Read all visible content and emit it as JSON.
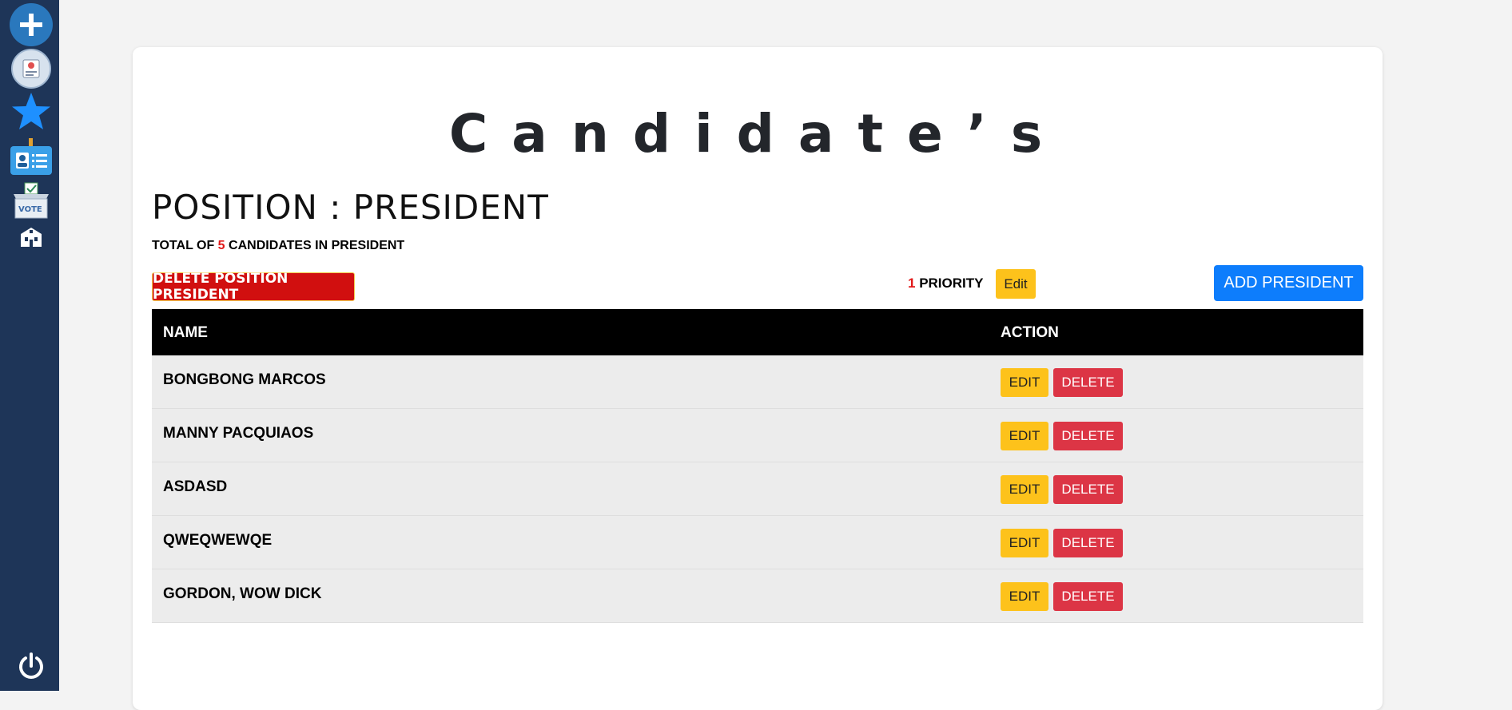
{
  "sidebar": {
    "icons": [
      "plus-icon",
      "election-avatar-icon",
      "star-icon",
      "id-card-icon",
      "ballot-box-icon",
      "school-icon",
      "power-icon"
    ]
  },
  "page": {
    "title": "Candidate’s",
    "position_label": "POSITION : PRESIDENT",
    "total_prefix": "TOTAL OF ",
    "total_count": "5",
    "total_suffix": " CANDIDATES IN PRESIDENT"
  },
  "toolbar": {
    "delete_position_label": "DELETE POSITION PRESIDENT",
    "priority_value": "1",
    "priority_label": " PRIORITY",
    "priority_edit_label": "Edit",
    "add_label": "ADD PRESIDENT"
  },
  "table": {
    "headers": [
      "NAME",
      "ACTION"
    ],
    "rows": [
      {
        "name": "BONGBONG MARCOS",
        "edit": "EDIT",
        "delete": "DELETE"
      },
      {
        "name": "MANNY PACQUIAOS",
        "edit": "EDIT",
        "delete": "DELETE"
      },
      {
        "name": "ASDASD",
        "edit": "EDIT",
        "delete": "DELETE"
      },
      {
        "name": "QWEQWEWQE",
        "edit": "EDIT",
        "delete": "DELETE"
      },
      {
        "name": "GORDON, WOW DICK",
        "edit": "EDIT",
        "delete": "DELETE"
      }
    ]
  },
  "colors": {
    "sidebar": "#1e3558",
    "danger": "#dc3545",
    "warning": "#fdc21b",
    "primary": "#0d7dfc",
    "accent_red": "#e11919"
  }
}
